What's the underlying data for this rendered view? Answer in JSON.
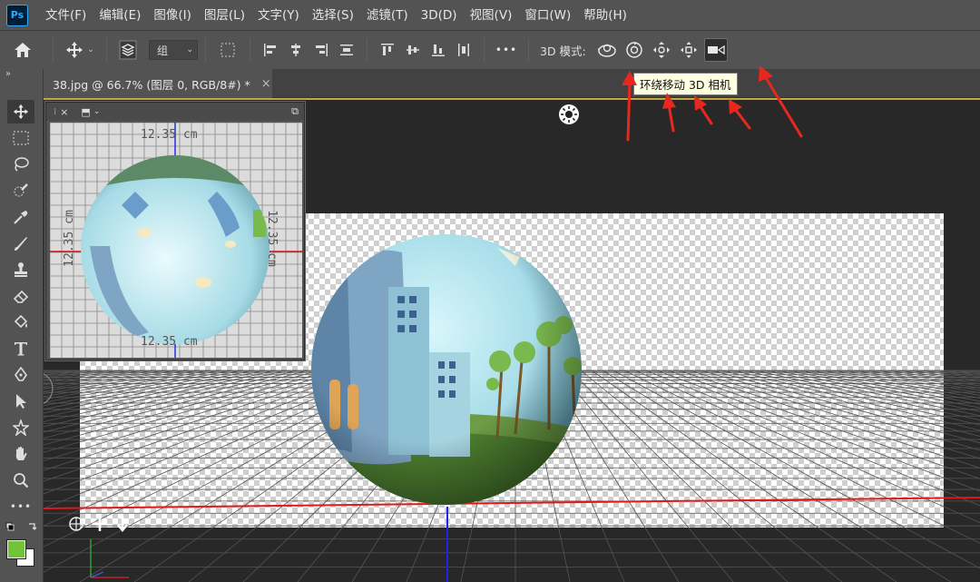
{
  "app": {
    "logo": "Ps"
  },
  "menu": [
    "文件(F)",
    "编辑(E)",
    "图像(I)",
    "图层(L)",
    "文字(Y)",
    "选择(S)",
    "滤镜(T)",
    "3D(D)",
    "视图(V)",
    "窗口(W)",
    "帮助(H)"
  ],
  "options": {
    "group_select": "组",
    "more": "•••",
    "mode_label": "3D 模式:",
    "mode_icons": [
      "orbit-3d-camera-icon",
      "roll-3d-camera-icon",
      "pan-3d-camera-icon",
      "slide-3d-camera-icon",
      "zoom-3d-camera-icon"
    ]
  },
  "tooltip": "环绕移动 3D 相机",
  "tab": {
    "title": "38.jpg @ 66.7% (图层 0, RGB/8#) *",
    "close": "×"
  },
  "secondary_view": {
    "dims": {
      "top": "12.35 cm",
      "bottom": "12.35 cm",
      "left": "12.35 cm",
      "right": "12.35 cm"
    }
  },
  "colors": {
    "foreground": "#73c33a",
    "background": "#ffffff",
    "accent": "#c8a53c",
    "arrow": "#e8281e"
  }
}
